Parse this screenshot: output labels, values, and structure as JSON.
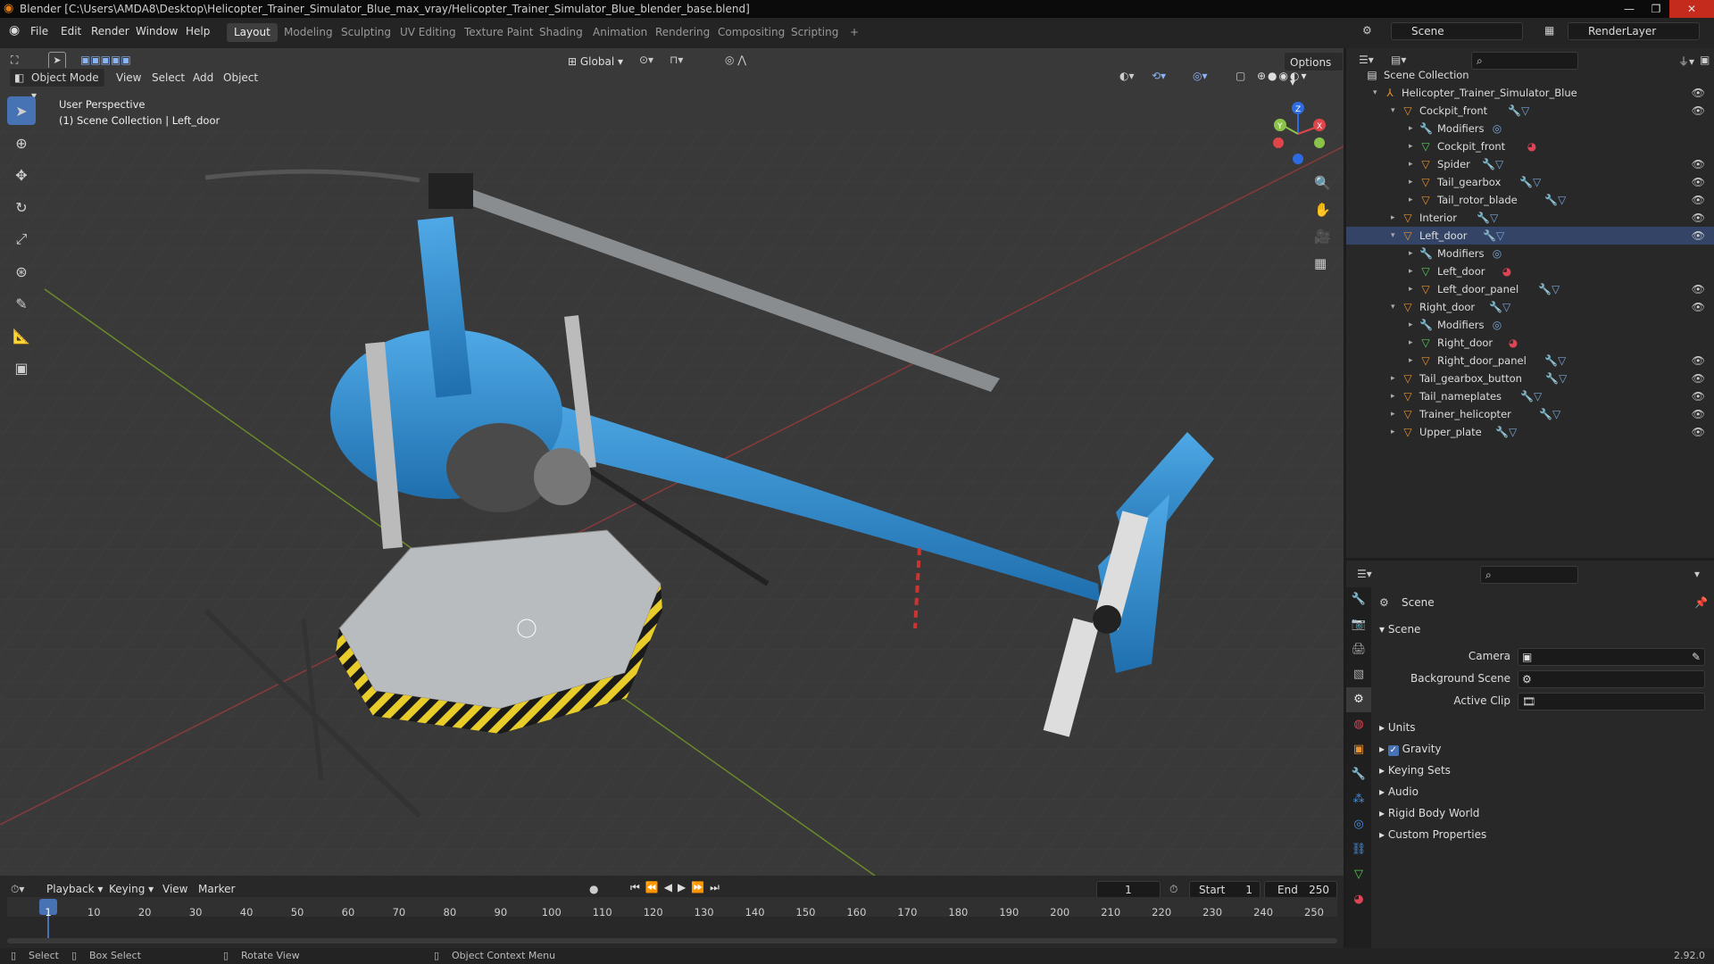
{
  "title_bar": {
    "text": "Blender [C:\\Users\\AMDA8\\Desktop\\Helicopter_Trainer_Simulator_Blue_max_vray/Helicopter_Trainer_Simulator_Blue_blender_base.blend]"
  },
  "menu": [
    "File",
    "Edit",
    "Render",
    "Window",
    "Help"
  ],
  "workspaces": [
    "Layout",
    "Modeling",
    "Sculpting",
    "UV Editing",
    "Texture Paint",
    "Shading",
    "Animation",
    "Rendering",
    "Compositing",
    "Scripting",
    "+"
  ],
  "scene_field": "Scene",
  "render_layer_field": "RenderLayer",
  "viewport_header": {
    "mode": "Object Mode",
    "view": "View",
    "select": "Select",
    "add": "Add",
    "object": "Object",
    "transform": "Global",
    "options": "Options"
  },
  "viewport_overlay": {
    "line1": "User Perspective",
    "line2": "(1) Scene Collection | Left_door"
  },
  "gizmo": {
    "x": "X",
    "y": "Y",
    "z": "Z"
  },
  "outliner": {
    "root": "Scene Collection",
    "items": [
      {
        "label": "Helicopter_Trainer_Simulator_Blue",
        "type": "empty"
      },
      {
        "label": "Cockpit_front",
        "type": "object"
      },
      {
        "label": "Modifiers",
        "type": "mod"
      },
      {
        "label": "Cockpit_front",
        "type": "mesh"
      },
      {
        "label": "Spider",
        "type": "object"
      },
      {
        "label": "Tail_gearbox",
        "type": "object"
      },
      {
        "label": "Tail_rotor_blade",
        "type": "object"
      },
      {
        "label": "Interior",
        "type": "object"
      },
      {
        "label": "Left_door",
        "type": "object"
      },
      {
        "label": "Modifiers",
        "type": "mod"
      },
      {
        "label": "Left_door",
        "type": "mesh"
      },
      {
        "label": "Left_door_panel",
        "type": "object"
      },
      {
        "label": "Right_door",
        "type": "object"
      },
      {
        "label": "Modifiers",
        "type": "mod"
      },
      {
        "label": "Right_door",
        "type": "mesh"
      },
      {
        "label": "Right_door_panel",
        "type": "object"
      },
      {
        "label": "Tail_gearbox_button",
        "type": "object"
      },
      {
        "label": "Tail_nameplates",
        "type": "object"
      },
      {
        "label": "Trainer_helicopter",
        "type": "object"
      },
      {
        "label": "Upper_plate",
        "type": "object"
      }
    ]
  },
  "properties": {
    "breadcrumb": "Scene",
    "panel": "Scene",
    "camera_label": "Camera",
    "background_scene_label": "Background Scene",
    "active_clip_label": "Active Clip",
    "sections": [
      "Units",
      "Gravity",
      "Keying Sets",
      "Audio",
      "Rigid Body World",
      "Custom Properties"
    ]
  },
  "timeline": {
    "playback": "Playback",
    "keying": "Keying",
    "view": "View",
    "marker": "Marker",
    "current_frame": "1",
    "start_label": "Start",
    "start": "1",
    "end_label": "End",
    "end": "250",
    "ticks": [
      "1",
      "10",
      "20",
      "30",
      "40",
      "50",
      "60",
      "70",
      "80",
      "90",
      "100",
      "110",
      "120",
      "130",
      "140",
      "150",
      "160",
      "170",
      "180",
      "190",
      "200",
      "210",
      "220",
      "230",
      "240",
      "250"
    ]
  },
  "status": {
    "select": "Select",
    "box_select": "Box Select",
    "rotate_view": "Rotate View",
    "context_menu": "Object Context Menu",
    "version": "2.92.0"
  }
}
